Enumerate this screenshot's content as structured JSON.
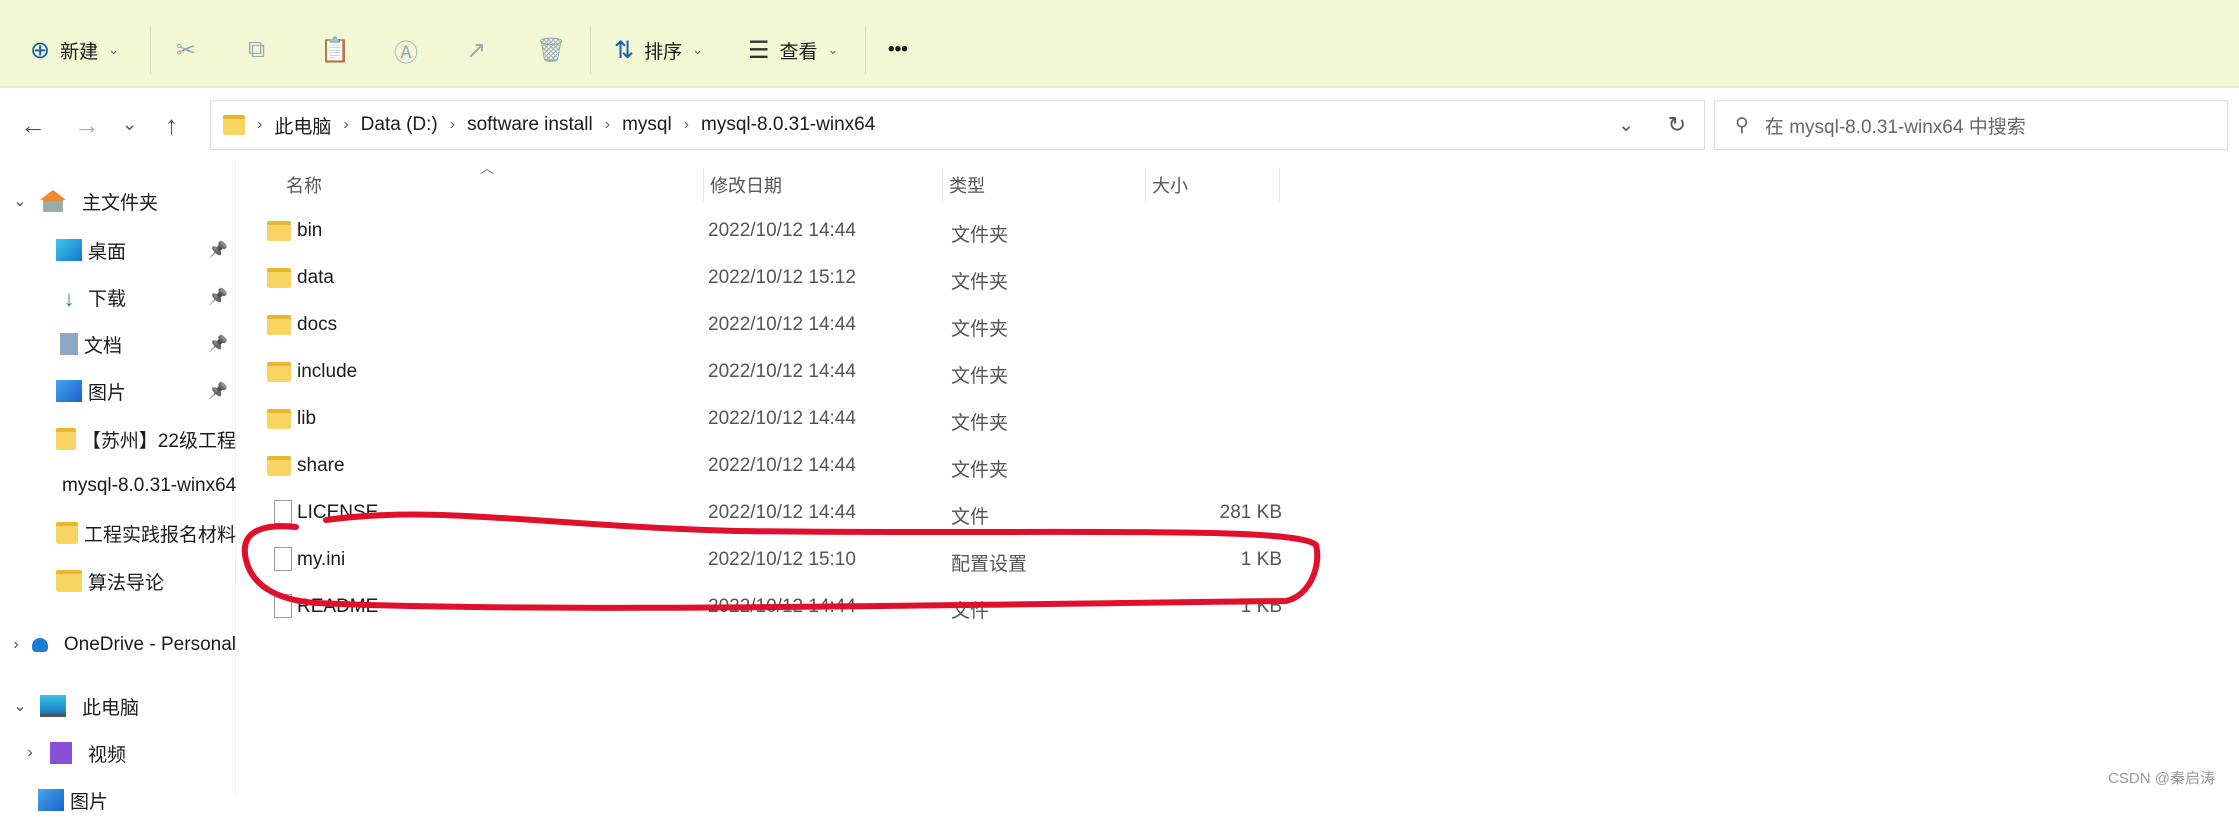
{
  "toolbar": {
    "new_label": "新建",
    "sort_label": "排序",
    "view_label": "查看",
    "more_label": "•••",
    "icons": [
      "cut-icon",
      "copy-icon",
      "paste-icon",
      "rename-icon",
      "share-icon",
      "delete-icon"
    ]
  },
  "address": {
    "crumbs": [
      "此电脑",
      "Data (D:)",
      "software install",
      "mysql",
      "mysql-8.0.31-winx64"
    ]
  },
  "search": {
    "placeholder": "在 mysql-8.0.31-winx64 中搜索"
  },
  "sidebar": {
    "items": [
      {
        "label": "主文件夹",
        "icon": "home-icon",
        "expand": "v"
      },
      {
        "label": "桌面",
        "icon": "desktop-icon",
        "pinned": true
      },
      {
        "label": "下载",
        "icon": "download-icon",
        "pinned": true
      },
      {
        "label": "文档",
        "icon": "documents-icon",
        "pinned": true
      },
      {
        "label": "图片",
        "icon": "pictures-icon",
        "pinned": true
      },
      {
        "label": "【苏州】22级工程",
        "icon": "folder-icon"
      },
      {
        "label": "mysql-8.0.31-winx64",
        "icon": "folder-icon"
      },
      {
        "label": "工程实践报名材料",
        "icon": "folder-icon"
      },
      {
        "label": "算法导论",
        "icon": "folder-icon"
      },
      {
        "label": "OneDrive - Personal",
        "icon": "onedrive-icon",
        "expand": ">"
      },
      {
        "label": "此电脑",
        "icon": "computer-icon",
        "expand": "v"
      },
      {
        "label": "视频",
        "icon": "videos-icon",
        "expand": ">"
      },
      {
        "label": "图片",
        "icon": "pictures-icon"
      }
    ]
  },
  "columns": {
    "name": "名称",
    "date": "修改日期",
    "type": "类型",
    "size": "大小"
  },
  "files": [
    {
      "name": "bin",
      "date": "2022/10/12 14:44",
      "type": "文件夹",
      "size": "",
      "kind": "folder"
    },
    {
      "name": "data",
      "date": "2022/10/12 15:12",
      "type": "文件夹",
      "size": "",
      "kind": "folder"
    },
    {
      "name": "docs",
      "date": "2022/10/12 14:44",
      "type": "文件夹",
      "size": "",
      "kind": "folder"
    },
    {
      "name": "include",
      "date": "2022/10/12 14:44",
      "type": "文件夹",
      "size": "",
      "kind": "folder"
    },
    {
      "name": "lib",
      "date": "2022/10/12 14:44",
      "type": "文件夹",
      "size": "",
      "kind": "folder"
    },
    {
      "name": "share",
      "date": "2022/10/12 14:44",
      "type": "文件夹",
      "size": "",
      "kind": "folder"
    },
    {
      "name": "LICENSE",
      "date": "2022/10/12 14:44",
      "type": "文件",
      "size": "281 KB",
      "kind": "file"
    },
    {
      "name": "my.ini",
      "date": "2022/10/12 15:10",
      "type": "配置设置",
      "size": "1 KB",
      "kind": "file"
    },
    {
      "name": "README",
      "date": "2022/10/12 14:44",
      "type": "文件",
      "size": "1 KB",
      "kind": "file"
    }
  ],
  "annotation_color": "#e0102a",
  "watermark": "CSDN @秦启涛"
}
